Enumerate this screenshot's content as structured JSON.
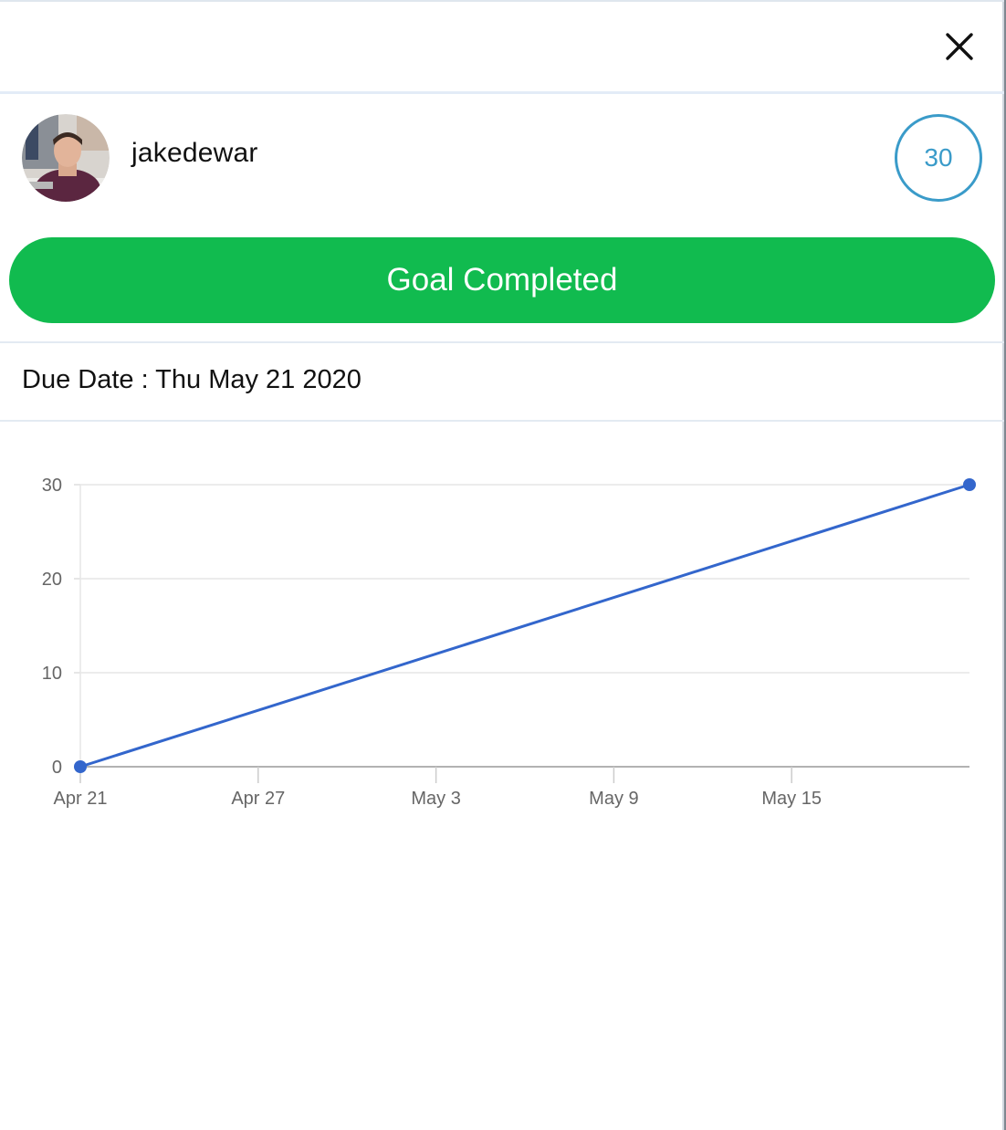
{
  "modal": {
    "close_icon": "close-icon",
    "username": "jakedewar",
    "avatar_icon": "user-avatar-photo",
    "score": "30",
    "goal_button_label": "Goal Completed",
    "due_date_label": "Due Date : Thu May 21 2020",
    "colors": {
      "goal_green": "#11bb4f",
      "score_blue": "#3a9bc9",
      "line_blue": "#3366cc"
    }
  },
  "chart_data": {
    "type": "line",
    "title": "",
    "xlabel": "",
    "ylabel": "",
    "x": [
      "2020-04-21",
      "2020-05-21"
    ],
    "series": [
      {
        "values": [
          0,
          30
        ],
        "color": "#3366cc"
      }
    ],
    "x_ticks": [
      "Apr 21",
      "Apr 27",
      "May 3",
      "May 9",
      "May 15"
    ],
    "y_ticks": [
      "0",
      "10",
      "20",
      "30"
    ],
    "ylim": [
      0,
      30
    ],
    "xlim": [
      "2020-04-21",
      "2020-05-21"
    ],
    "grid": true,
    "legend": "none"
  }
}
